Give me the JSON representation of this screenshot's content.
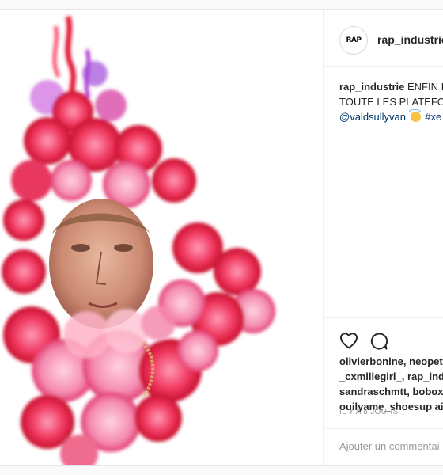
{
  "post": {
    "username": "rap_industrie",
    "avatar_logo": "RAP",
    "caption": {
      "user": "rap_industrie",
      "line1": "ENFIN I",
      "line2": "TOUTE LES PLATEFO",
      "mention": "@valdsullyvan",
      "hashtag": "#xe"
    },
    "likes": {
      "line1": "olivierbonine, neopet",
      "line2": "_cxmillegirl_, rap_ind",
      "line3": "sandraschmtt, bobox",
      "line4": "ouilyame_shoesup ai"
    },
    "timestamp": "IL Y A 5 JOURS",
    "comment_placeholder": "Ajouter un commentai",
    "icons": {
      "like": "heart-icon",
      "comment": "comment-icon",
      "emoji": "halo-smile-emoji"
    }
  },
  "colors": {
    "username_link": "#003569",
    "timestamp": "#999999",
    "divider": "#efefef"
  }
}
